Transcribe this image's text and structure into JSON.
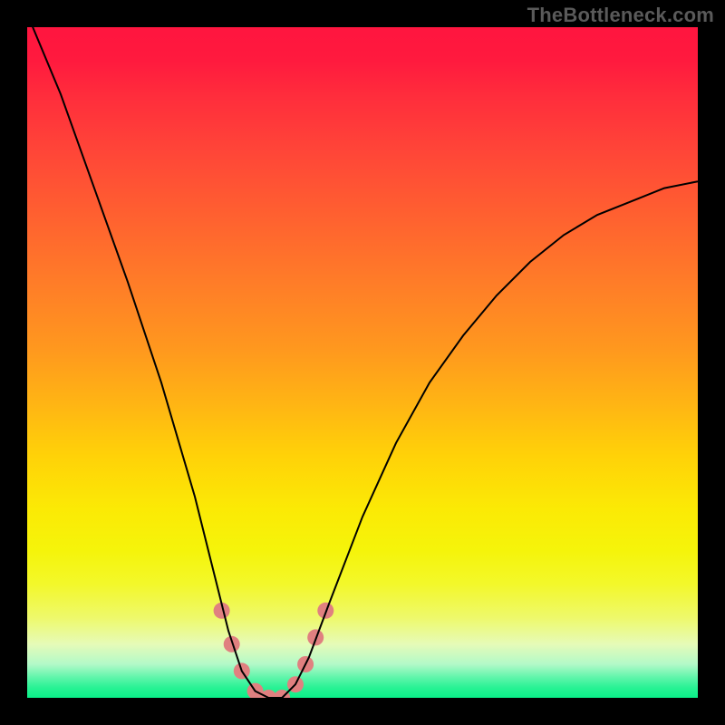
{
  "watermark": "TheBottleneck.com",
  "chart_data": {
    "type": "line",
    "title": "",
    "xlabel": "",
    "ylabel": "",
    "xlim": [
      0,
      100
    ],
    "ylim": [
      0,
      100
    ],
    "grid": false,
    "legend": false,
    "series": [
      {
        "name": "bottleneck-curve",
        "x": [
          0,
          5,
          10,
          15,
          20,
          25,
          28,
          30,
          32,
          34,
          36,
          38,
          40,
          42,
          45,
          50,
          55,
          60,
          65,
          70,
          75,
          80,
          85,
          90,
          95,
          100
        ],
        "values": [
          102,
          90,
          76,
          62,
          47,
          30,
          18,
          10,
          4,
          1,
          0,
          0,
          2,
          6,
          14,
          27,
          38,
          47,
          54,
          60,
          65,
          69,
          72,
          74,
          76,
          77
        ]
      }
    ],
    "markers": {
      "name": "bottleneck-markers",
      "x": [
        29,
        30.5,
        32,
        34,
        36,
        38,
        40,
        41.5,
        43,
        44.5
      ],
      "values": [
        13,
        8,
        4,
        1,
        0,
        0,
        2,
        5,
        9,
        13
      ],
      "color": "#e08080",
      "size": 18
    },
    "background_gradient": {
      "stops": [
        {
          "pos": 0,
          "color": "#ff153f"
        },
        {
          "pos": 50,
          "color": "#ff981e"
        },
        {
          "pos": 75,
          "color": "#fbea05"
        },
        {
          "pos": 92,
          "color": "#e6fbb8"
        },
        {
          "pos": 100,
          "color": "#0af089"
        }
      ]
    }
  }
}
